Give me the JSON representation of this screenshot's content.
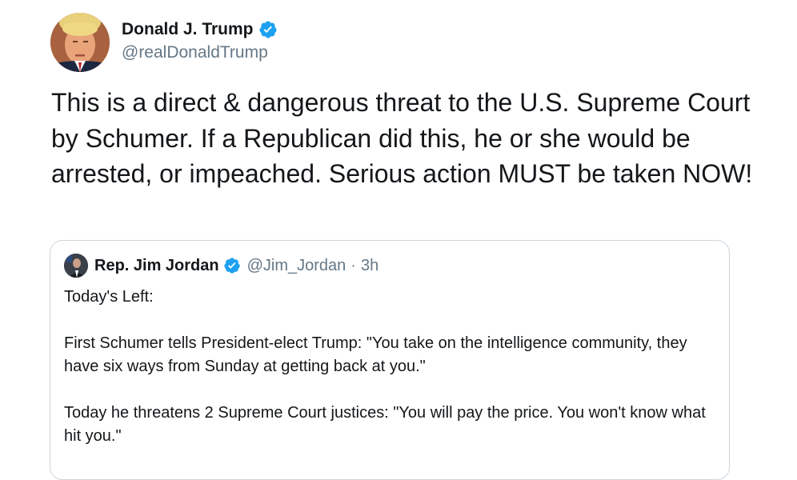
{
  "tweet": {
    "author": {
      "name": "Donald J. Trump",
      "handle": "@realDonaldTrump",
      "verified_icon": "verified-badge-icon"
    },
    "text": "This is a direct & dangerous threat to the U.S. Supreme Court by Schumer. If a Republican did this, he or she would be arrested, or impeached. Serious action MUST be taken NOW!",
    "quoted_tweet": {
      "author": {
        "name": "Rep. Jim Jordan",
        "handle": "@Jim_Jordan",
        "separator": "·",
        "time": "3h",
        "verified_icon": "verified-badge-icon"
      },
      "paragraphs": [
        "Today's Left:",
        "First Schumer tells President-elect Trump: \"You take on the intelligence community, they have six ways from Sunday at getting back at you.\"",
        "Today he threatens 2 Supreme Court justices: \"You will pay the price. You won't know what hit you.\""
      ]
    }
  },
  "colors": {
    "text_primary": "#14171a",
    "text_secondary": "#657786",
    "verified_blue": "#1da1f2",
    "border": "#ccd6dd"
  }
}
